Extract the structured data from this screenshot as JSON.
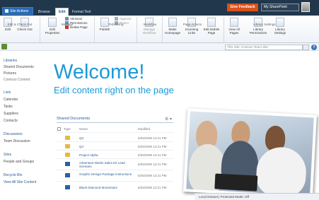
{
  "topbar": {
    "site_actions": "Site Actions",
    "tabs": [
      "Browse",
      "Edit",
      "Format Text"
    ],
    "active_tab": "Edit",
    "give_feedback": "Give Feedback",
    "user_name": "My SharePoint"
  },
  "ribbon": {
    "edit": "Edit",
    "check_out": "Check Out",
    "edit_page_group": "Edit & Check Out",
    "edit_properties": "Edit Properties",
    "versions": "Versions",
    "permissions": "Permissions",
    "delete_page": "Delete Page",
    "manage_group": "Manage",
    "publish": "Publish",
    "approve": "Approve",
    "reject": "Reject",
    "publishing_group": "Publishing",
    "manage_workflow": "Manage Workflow",
    "workflow_group": "Workflow",
    "make_homepage": "Make Homepage",
    "incoming_links": "Incoming Links",
    "edit_mobile_page": "Edit Mobile Page",
    "page_actions_group": "Page Actions",
    "view_all_pages": "View All Pages",
    "library_permissions": "Library Permissions",
    "library_settings": "Library Settings",
    "library_settings_group": "Library Settings"
  },
  "search": {
    "placeholder": "This Site: Contoso Team Site"
  },
  "nav": {
    "libraries": "Libraries",
    "shared_documents": "Shared Documents",
    "pictures": "Pictures",
    "contoso_content": "Contoso Content",
    "lists": "Lists",
    "calendar": "Calendar",
    "tasks": "Tasks",
    "suppliers": "Suppliers",
    "contacts": "Contacts",
    "discussions": "Discussions",
    "team_discussion": "Team Discussion",
    "sites": "Sites",
    "people_groups": "People and Groups",
    "recycle_bin": "Recycle Bin",
    "view_all": "View All Site Content"
  },
  "main": {
    "welcome": "Welcome!",
    "subtitle": "Edit content right on the page",
    "doc_title": "Shared Documents",
    "col_type": "Type",
    "col_name": "Name",
    "col_modified": "Modified",
    "rows": [
      {
        "type": "folder",
        "name": "Q3",
        "modified": "6/25/2009 12:21 PM"
      },
      {
        "type": "folder",
        "name": "Q4",
        "modified": "6/25/2009 12:21 PM"
      },
      {
        "type": "folder",
        "name": "Project Alpha",
        "modified": "6/25/2009 12:21 PM"
      },
      {
        "type": "doc",
        "name": "Adventure Works Sales Kit Lead Scenario",
        "modified": "6/25/2009 12:21 PM"
      },
      {
        "type": "doc",
        "name": "Graphic Design Package Instructions",
        "modified": "6/25/2009 12:21 PM"
      },
      {
        "type": "doc",
        "name": "Black Diamond Momentum",
        "modified": "6/25/2009 12:21 PM"
      }
    ]
  },
  "statusbar": {
    "text": "Local intranet | Protected Mode: Off"
  },
  "colors": {
    "topbar": "#21374c",
    "accent": "#1b9ad8",
    "feedback": "#d9521b"
  }
}
